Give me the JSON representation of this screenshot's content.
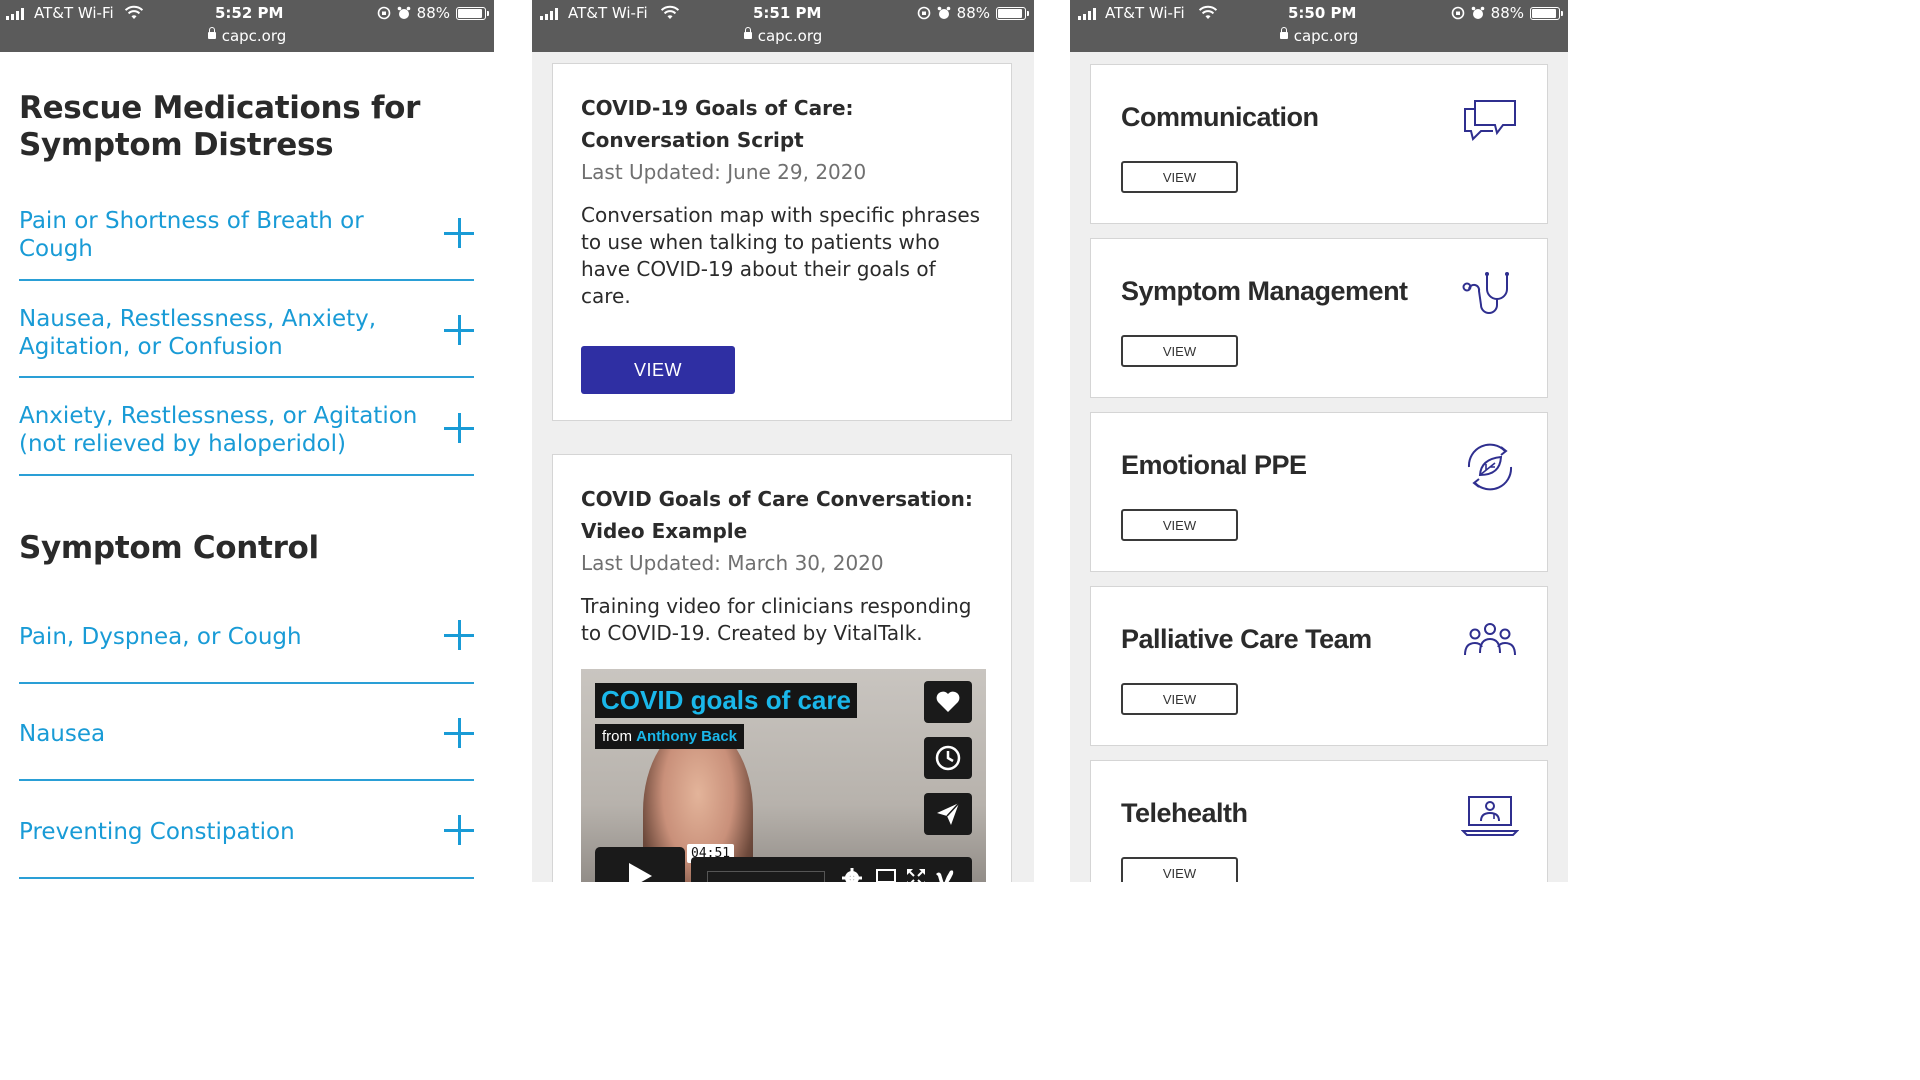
{
  "status_bars": [
    {
      "carrier": "AT&T Wi-Fi",
      "time": "5:52 PM",
      "battery": "88%",
      "url": "capc.org"
    },
    {
      "carrier": "AT&T Wi-Fi",
      "time": "5:51 PM",
      "battery": "88%",
      "url": "capc.org"
    },
    {
      "carrier": "AT&T Wi-Fi",
      "time": "5:50 PM",
      "battery": "88%",
      "url": "capc.org"
    }
  ],
  "panel1": {
    "heading_rescue": "Rescue Medications for Symptom Distress",
    "rescue_items": [
      {
        "label": "Pain or Shortness of Breath or Cough"
      },
      {
        "label": "Nausea, Restlessness, Anxiety, Agitation, or Confusion"
      },
      {
        "label": "Anxiety, Restlessness, or Agitation (not relieved by haloperidol)"
      }
    ],
    "heading_control": "Symptom Control",
    "control_items": [
      {
        "label": "Pain, Dyspnea, or Cough"
      },
      {
        "label": "Nausea"
      },
      {
        "label": "Preventing Constipation"
      }
    ],
    "accent_color": "#199bd6"
  },
  "panel2": {
    "cards": [
      {
        "title": "COVID-19 Goals of Care: Conversation Script",
        "date": "Last Updated: June 29, 2020",
        "description": "Conversation map with specific phrases to use when talking to patients who have COVID-19 about their goals of care.",
        "button": "VIEW"
      },
      {
        "title": "COVID Goals of Care Conversation: Video Example",
        "date": "Last Updated: March 30, 2020",
        "description": "Training video for clinicians responding to COVID-19. Created by VitalTalk.",
        "video": {
          "title": "COVID goals of care",
          "from": "from",
          "author": "Anthony Back",
          "duration": "04:51"
        }
      }
    ],
    "button_color": "#2f2fa3"
  },
  "panel3": {
    "cards": [
      {
        "title": "Communication",
        "button": "VIEW",
        "icon": "speech-bubbles-icon"
      },
      {
        "title": "Symptom Management",
        "button": "VIEW",
        "icon": "stethoscope-icon"
      },
      {
        "title": "Emotional PPE",
        "button": "VIEW",
        "icon": "leaf-cycle-icon"
      },
      {
        "title": "Palliative Care Team",
        "button": "VIEW",
        "icon": "team-icon"
      },
      {
        "title": "Telehealth",
        "button": "VIEW",
        "icon": "laptop-doctor-icon"
      }
    ],
    "icon_color": "#2f2f8f"
  }
}
